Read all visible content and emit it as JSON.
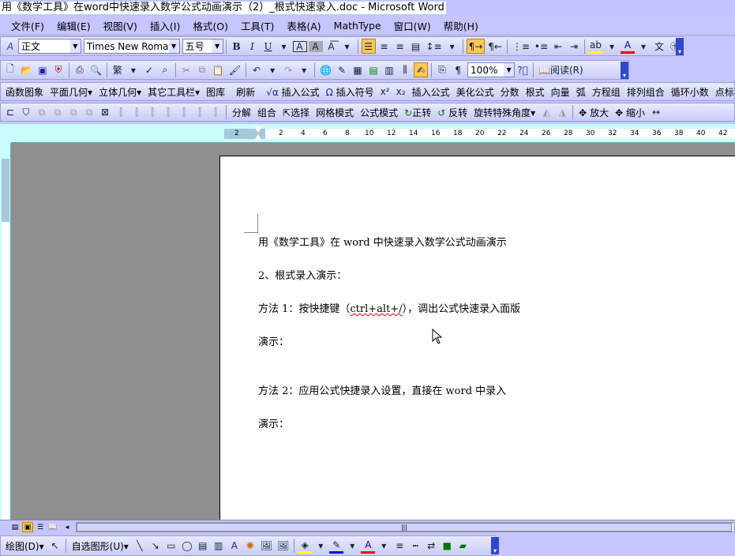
{
  "window": {
    "title": "用《数学工具》在word中快速录入数学公式动画演示（2）_根式快速录入.doc - Microsoft Word"
  },
  "menu": [
    "文件(F)",
    "编辑(E)",
    "视图(V)",
    "插入(I)",
    "格式(O)",
    "工具(T)",
    "表格(A)",
    "MathType",
    "窗口(W)",
    "帮助(H)"
  ],
  "format_toolbar": {
    "style": "正文",
    "font": "Times New Roman",
    "size": "五号"
  },
  "standard_toolbar": {
    "zoom": "100%",
    "read": "阅读(R)"
  },
  "math_toolbar": [
    "函数图象",
    "平面几何",
    "立体几何",
    "其它工具栏",
    "图库",
    "刷新",
    "插入公式",
    "插入符号",
    "插入公式",
    "美化公式",
    "分数",
    "根式",
    "向量",
    "弧",
    "方程组",
    "排列组合",
    "循环小数",
    "点标"
  ],
  "geometry_toolbar": [
    "分解",
    "组合",
    "选择",
    "网格模式",
    "公式模式",
    "正转",
    "反转",
    "旋转特殊角度",
    "放大",
    "缩小"
  ],
  "ruler": {
    "ticks": [
      "2",
      "2",
      "4",
      "6",
      "8",
      "10",
      "12",
      "14",
      "16",
      "18",
      "20",
      "22",
      "24",
      "26",
      "28",
      "30",
      "32",
      "34",
      "36",
      "38",
      "40",
      "42"
    ]
  },
  "document": {
    "lines": [
      "用《数学工具》在 word 中快速录入数学公式动画演示",
      "2、根式录入演示：",
      "方法 1：按快捷键（",
      "ctrl+alt+/",
      "），调出公式快速录入面版",
      "演示：",
      "方法 2：应用公式快捷录入设置，直接在 word 中录入",
      "演示："
    ]
  },
  "drawing_toolbar": {
    "draw": "绘图(D)",
    "autoshapes": "自选图形(U)"
  }
}
